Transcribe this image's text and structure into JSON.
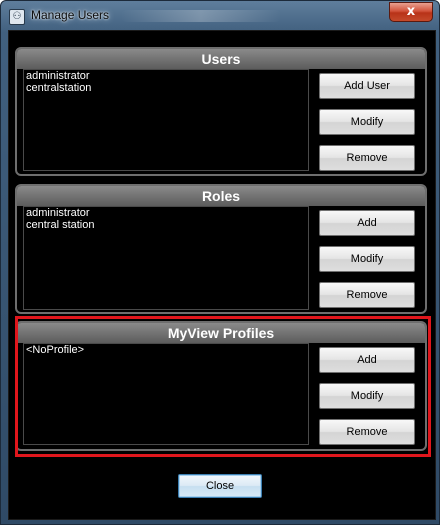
{
  "window": {
    "title": "Manage Users",
    "close_glyph": "x",
    "app_icon": "users-icon"
  },
  "users": {
    "header": "Users",
    "items": [
      "administrator",
      "centralstation"
    ],
    "buttons": [
      "Add User",
      "Modify",
      "Remove"
    ]
  },
  "roles": {
    "header": "Roles",
    "items": [
      "administrator",
      "central station"
    ],
    "buttons": [
      "Add",
      "Modify",
      "Remove"
    ]
  },
  "profiles": {
    "header": "MyView Profiles",
    "items": [
      "<NoProfile>"
    ],
    "buttons": [
      "Add",
      "Modify",
      "Remove"
    ]
  },
  "footer": {
    "close_label": "Close"
  },
  "colors": {
    "highlight": "#e0161c",
    "panel_bg": "#000000",
    "header_gray": "#6e6e6e"
  }
}
